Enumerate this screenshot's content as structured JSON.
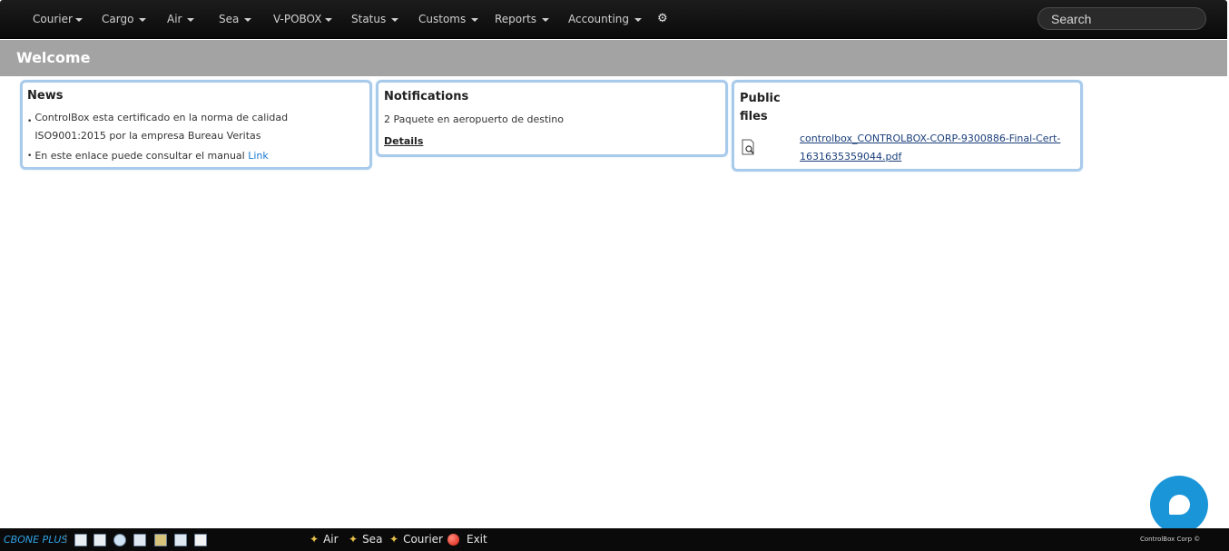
{
  "nav": {
    "items": [
      {
        "label": "Courier"
      },
      {
        "label": "Cargo"
      },
      {
        "label": "Air"
      },
      {
        "label": "Sea"
      },
      {
        "label": "V-POBOX"
      },
      {
        "label": "Status"
      },
      {
        "label": "Customs"
      },
      {
        "label": "Reports"
      },
      {
        "label": "Accounting"
      }
    ],
    "settings_icon": "gear-icon",
    "search_placeholder": "Search"
  },
  "welcome": {
    "title": "Welcome"
  },
  "news": {
    "title": "News",
    "items": [
      {
        "text": "ControlBox esta certificado en la norma de calidad ISO9001:2015 por la empresa Bureau Veritas"
      },
      {
        "text": "En este enlace puede consultar el manual ",
        "link": "Link"
      }
    ]
  },
  "notifications": {
    "title": "Notifications",
    "message": "2 Paquete en aeropuerto de destino",
    "details_label": "Details"
  },
  "public_files": {
    "title": "Public files",
    "file_name": "controlbox_CONTROLBOX-CORP-9300886-Final-Cert-1631635359044.pdf",
    "file_icon": "document-search-icon"
  },
  "chat": {
    "icon": "chat-bubble-icon",
    "color": "#1a96d8"
  },
  "bottom": {
    "brand": "CBONE PLUS",
    "separator": "|",
    "toolbar_icons": [
      "co-icon",
      "wr-icon",
      "magnify-icon",
      "document-icon",
      "package-icon",
      "copy-icon",
      "pages-icon"
    ],
    "quick_links": [
      {
        "label": "Air",
        "icon": "magic-wand-icon"
      },
      {
        "label": "Sea",
        "icon": "magic-wand-icon"
      },
      {
        "label": "Courier",
        "icon": "magic-wand-icon"
      },
      {
        "label": "Exit",
        "icon": "exit-icon"
      }
    ],
    "copyright": "ControlBox Corp ©"
  }
}
